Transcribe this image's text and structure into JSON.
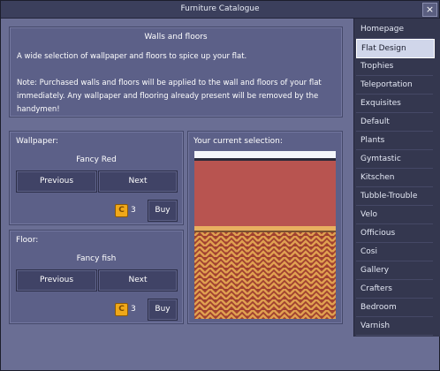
{
  "window": {
    "title": "Furniture Catalogue",
    "close_label": "×"
  },
  "info": {
    "title": "Walls and floors",
    "line1": "A wide selection of wallpaper and floors to spice up your flat.",
    "line2": "Note: Purchased walls and floors will be applied to the wall and floors of your flat immediately. Any wallpaper and flooring already present will be removed by the handymen!"
  },
  "wallpaper": {
    "label": "Wallpaper:",
    "name": "Fancy Red",
    "prev_label": "Previous",
    "next_label": "Next",
    "currency_icon": "C",
    "price": "3",
    "buy_label": "Buy"
  },
  "floor": {
    "label": "Floor:",
    "name": "Fancy fish",
    "prev_label": "Previous",
    "next_label": "Next",
    "currency_icon": "C",
    "price": "3",
    "buy_label": "Buy"
  },
  "preview": {
    "label": "Your current selection:"
  },
  "sidebar": {
    "selected_index": 1,
    "items": [
      "Homepage",
      "Flat Design",
      "Trophies",
      "Teleportation",
      "Exquisites",
      "Default",
      "Plants",
      "Gymtastic",
      "Kitschen",
      "Tubble-Trouble",
      "Velo",
      "Officious",
      "Cosi",
      "Gallery",
      "Crafters",
      "Bedroom",
      "Varnish"
    ]
  },
  "colors": {
    "wall": "#b85450",
    "floor_light": "#d89048",
    "floor_dark": "#a04030",
    "coin": "#f0a818",
    "selected_bg": "#d0d6ea"
  }
}
